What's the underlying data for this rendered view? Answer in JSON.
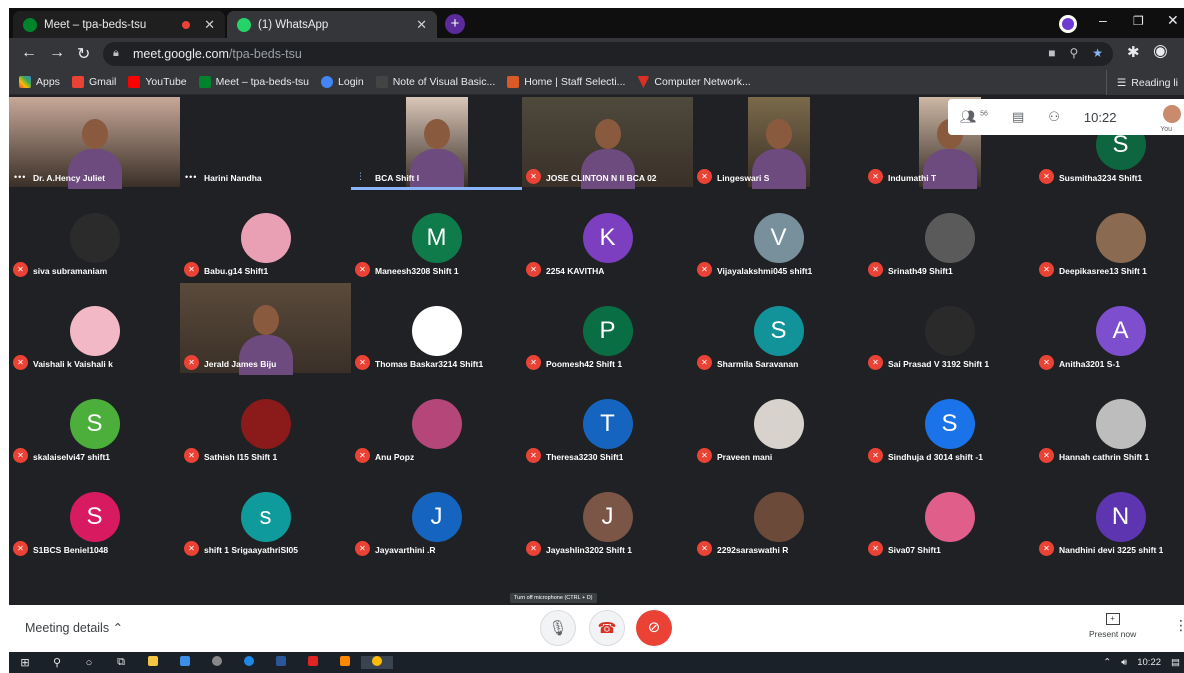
{
  "browser": {
    "tabs": [
      {
        "title": "Meet – tpa-beds-tsu",
        "favicon": "meet-icon",
        "recording": true,
        "active": true
      },
      {
        "title": "(1) WhatsApp",
        "favicon": "whatsapp-icon",
        "active": false
      }
    ],
    "url_domain": "meet.google.com",
    "url_path": "/tpa-beds-tsu",
    "bookmarks": [
      {
        "label": "Apps",
        "color": "#ea4335"
      },
      {
        "label": "Gmail",
        "color": "#ea4335"
      },
      {
        "label": "YouTube",
        "color": "#ff0000"
      },
      {
        "label": "Meet – tpa-beds-tsu",
        "color": "#00832d"
      },
      {
        "label": "Login",
        "color": "#4285f4"
      },
      {
        "label": "Note of Visual Basic...",
        "color": "#444444"
      },
      {
        "label": "Home | Staff Selecti...",
        "color": "#d95a29"
      },
      {
        "label": "Computer Network...",
        "color": "#d93025"
      }
    ],
    "reading_list": "Reading li"
  },
  "meet": {
    "participant_count": "56",
    "time": "10:22",
    "self_label": "You",
    "tiles": [
      {
        "name": "Dr. A.Hency Juliet",
        "type": "video",
        "muted": false
      },
      {
        "name": "Harini Nandha",
        "type": "blank",
        "muted": false
      },
      {
        "name": "BCA Shift I",
        "type": "video",
        "muted": false,
        "speaking": true
      },
      {
        "name": "JOSE CLINTON N II BCA 02",
        "type": "video",
        "muted": true
      },
      {
        "name": "Lingeswari S",
        "type": "video",
        "muted": true
      },
      {
        "name": "Indumathi T",
        "type": "video",
        "muted": true
      },
      {
        "name": "Susmitha3234 Shift1",
        "type": "letter",
        "letter": "S",
        "color": "#0d6640",
        "muted": true
      },
      {
        "name": "siva subramaniam",
        "type": "photo",
        "color": "#2b2b2b",
        "muted": true
      },
      {
        "name": "Babu.g14 Shift1",
        "type": "photo",
        "color": "#e9a0b5",
        "muted": true
      },
      {
        "name": "Maneesh3208 Shift 1",
        "type": "letter",
        "letter": "M",
        "color": "#0f7b4a",
        "muted": true
      },
      {
        "name": "2254 KAVITHA",
        "type": "letter",
        "letter": "K",
        "color": "#7b3fbf",
        "muted": true
      },
      {
        "name": "Vijayalakshmi045 shift1",
        "type": "letter",
        "letter": "V",
        "color": "#78909c",
        "muted": true
      },
      {
        "name": "Srinath49 Shift1",
        "type": "photo",
        "color": "#5a5a5a",
        "muted": true
      },
      {
        "name": "Deepikasree13 Shift 1",
        "type": "photo",
        "color": "#8b6a52",
        "muted": true
      },
      {
        "name": "Vaishali k Vaishali k",
        "type": "photo",
        "color": "#f2b8c6",
        "muted": true
      },
      {
        "name": "Jerald James Biju",
        "type": "video",
        "muted": true
      },
      {
        "name": "Thomas Baskar3214 Shift1",
        "type": "photo",
        "color": "#ffffff",
        "muted": true
      },
      {
        "name": "Poomesh42 Shift 1",
        "type": "letter",
        "letter": "P",
        "color": "#0a6e45",
        "muted": true
      },
      {
        "name": "Sharmila Saravanan",
        "type": "letter",
        "letter": "S",
        "color": "#12939a",
        "muted": true
      },
      {
        "name": "Sai Prasad V 3192 Shift 1",
        "type": "photo",
        "color": "#2a2a2a",
        "muted": true
      },
      {
        "name": "Anitha3201 S-1",
        "type": "letter",
        "letter": "A",
        "color": "#7d4fcf",
        "muted": true
      },
      {
        "name": "skalaiselvi47 shift1",
        "type": "letter",
        "letter": "S",
        "color": "#4caf3c",
        "muted": true
      },
      {
        "name": "Sathish I15 Shift 1",
        "type": "photo",
        "color": "#8b1a1a",
        "muted": true
      },
      {
        "name": "Anu Popz",
        "type": "photo",
        "color": "#b4467a",
        "muted": true
      },
      {
        "name": "Theresa3230 Shift1",
        "type": "letter",
        "letter": "T",
        "color": "#1565c0",
        "muted": true
      },
      {
        "name": "Praveen mani",
        "type": "photo",
        "color": "#d7d2cc",
        "muted": true
      },
      {
        "name": "Sindhuja d 3014 shift -1",
        "type": "letter",
        "letter": "S",
        "color": "#1a73e8",
        "muted": true
      },
      {
        "name": "Hannah cathrin Shift 1",
        "type": "photo",
        "color": "#bdbdbd",
        "muted": true
      },
      {
        "name": "S1BCS Beniel1048",
        "type": "letter",
        "letter": "S",
        "color": "#d81b60",
        "muted": true
      },
      {
        "name": "shift 1 SrigaayathriSI05",
        "type": "letter",
        "letter": "s",
        "color": "#0f9b9b",
        "muted": true
      },
      {
        "name": "Jayavarthini .R",
        "type": "letter",
        "letter": "J",
        "color": "#1565c0",
        "muted": true
      },
      {
        "name": "Jayashlin3202 Shift 1",
        "type": "letter",
        "letter": "J",
        "color": "#7b5546",
        "muted": true
      },
      {
        "name": "2292saraswathi R",
        "type": "photo",
        "color": "#6b4a3a",
        "muted": true
      },
      {
        "name": "Siva07 Shift1",
        "type": "photo",
        "color": "#e05f8a",
        "muted": true
      },
      {
        "name": "Nandhini devi 3225 shift 1",
        "type": "letter",
        "letter": "N",
        "color": "#5e35b1",
        "muted": true
      }
    ]
  },
  "bottom": {
    "meeting_details": "Meeting details",
    "mic_tooltip": "Turn off microphone (CTRL + D)",
    "present_now": "Present now"
  },
  "taskbar": {
    "time": "10:22"
  }
}
